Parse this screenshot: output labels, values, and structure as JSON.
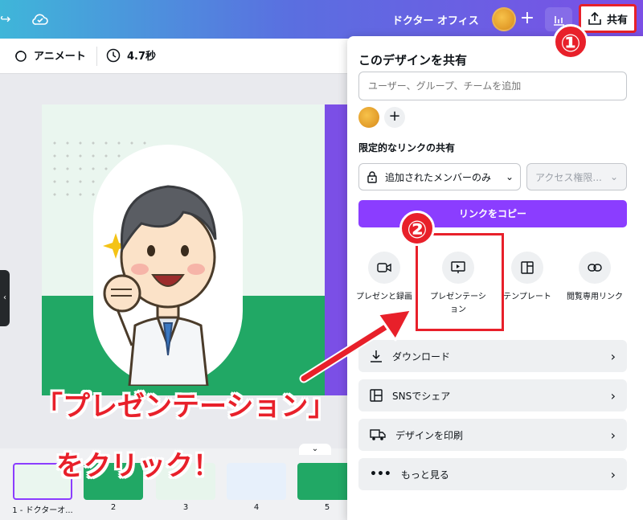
{
  "topbar": {
    "doc_title": "ドクター オフィス",
    "share_label": "共有",
    "icons": [
      "arrow-icon",
      "cloud-icon",
      "plus-icon",
      "chart-icon",
      "upload-icon"
    ],
    "gradient_colors": [
      "#3fb6d9",
      "#5a6fe0",
      "#7b4fe6"
    ]
  },
  "toolbar": {
    "animate_label": "アニメート",
    "duration_label": "4.7秒"
  },
  "share_panel": {
    "title": "このデザインを共有",
    "add_people_placeholder": "ユーザー、グループ、チームを追加",
    "link_section_label": "限定的なリンクの共有",
    "access_select_value": "追加されたメンバーのみ",
    "permission_select_value": "アクセス権限...",
    "copy_link_label": "リンクをコピー",
    "options": [
      {
        "label": "プレゼンと録画",
        "icon": "video-icon"
      },
      {
        "label": "プレゼンテーション",
        "icon": "present-icon"
      },
      {
        "label": "テンプレート",
        "icon": "template-icon"
      },
      {
        "label": "閲覧専用リンク",
        "icon": "link-icon"
      }
    ],
    "rows": [
      {
        "label": "ダウンロード",
        "icon": "download-icon"
      },
      {
        "label": "SNSでシェア",
        "icon": "social-icon"
      },
      {
        "label": "デザインを印刷",
        "icon": "truck-icon"
      },
      {
        "label": "もっと見る",
        "icon": "more-icon"
      }
    ],
    "accent_color": "#8b3dff"
  },
  "thumbnails": [
    {
      "label": "1 - ドクターオ..."
    },
    {
      "label": "2"
    },
    {
      "label": "3"
    },
    {
      "label": "4"
    },
    {
      "label": "5"
    }
  ],
  "annotations": {
    "step1": "①",
    "step2": "②",
    "callout_line1": "「プレゼンテーション」",
    "callout_line2": "をクリック！",
    "color": "#e8202a"
  }
}
